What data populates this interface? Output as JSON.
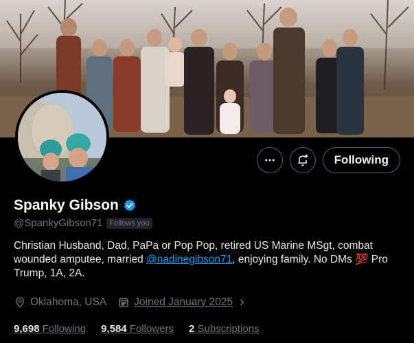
{
  "profile": {
    "name": "Spanky Gibson",
    "handle": "@SpankyGibson71",
    "follows_you": "Follows you",
    "bio_part1": "Christian Husband, Dad, PaPa or Pop Pop, retired US Marine MSgt, combat wounded amputee, married ",
    "bio_mention": "@nadinegibson71",
    "bio_part2": ", enjoying family. No DMs ",
    "bio_emoji": "💯",
    "bio_part3": " Pro Trump, 1A, 2A.",
    "location": "Oklahoma, USA",
    "joined": "Joined January 2025"
  },
  "actions": {
    "more_icon": "more-horizontal-icon",
    "notify_icon": "bell-plus-icon",
    "follow_label": "Following"
  },
  "stats": {
    "following_count": "9,698",
    "following_label": "Following",
    "followers_count": "9,584",
    "followers_label": "Followers",
    "subscriptions_count": "2",
    "subscriptions_label": "Subscriptions"
  },
  "colors": {
    "background": "#000000",
    "accent": "#1d9bf0",
    "muted": "#71767b",
    "verified": "#1d9bf0"
  }
}
